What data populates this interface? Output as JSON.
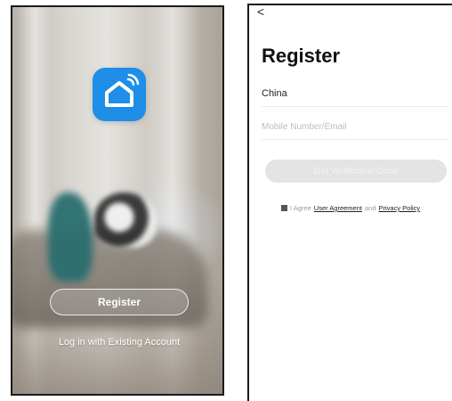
{
  "welcome_screen": {
    "register_label": "Register",
    "login_label": "Log in with Existing Account",
    "app_icon": "smart-home-icon",
    "icon_color": "#1e8ee8"
  },
  "register_screen": {
    "back_glyph": "<",
    "title": "Register",
    "country": "China",
    "contact_placeholder": "Mobile Number/Email",
    "get_code_label": "Get Verification Code",
    "agreement": {
      "prefix": "I Agree",
      "user_agreement": "User Agreement",
      "and": "and",
      "privacy_policy": "Privacy Policy"
    },
    "button_disabled_color": "#e4e4e4"
  }
}
